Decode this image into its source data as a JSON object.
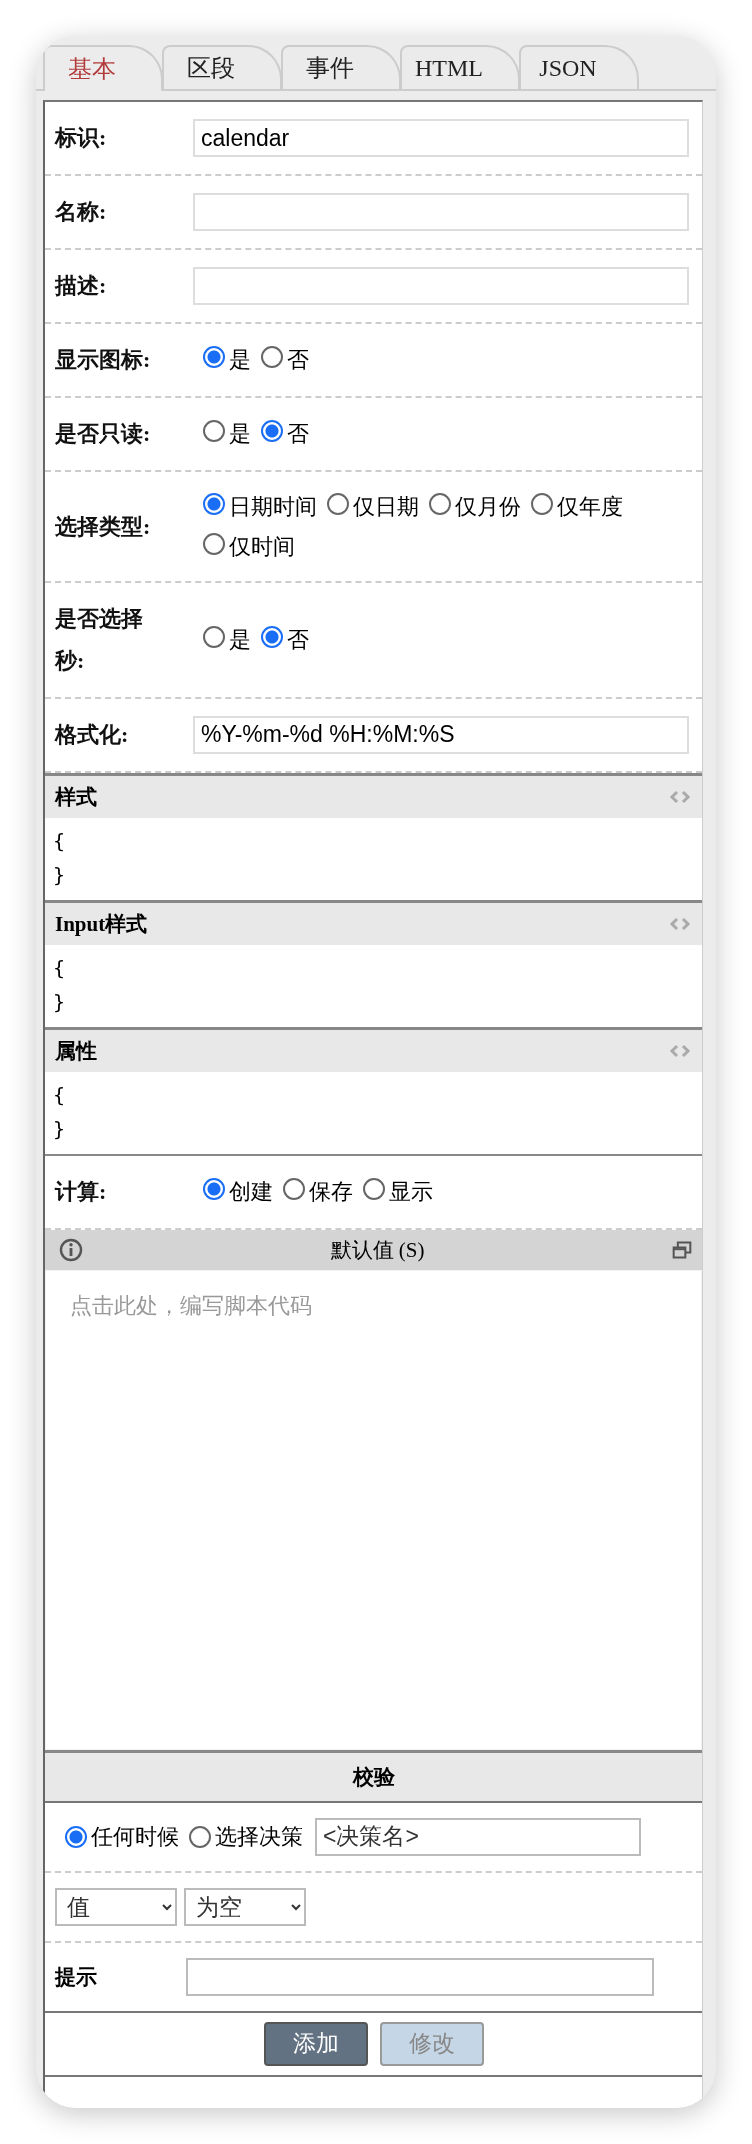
{
  "tabs": [
    {
      "label": "基本",
      "selected": true
    },
    {
      "label": "区段",
      "selected": false
    },
    {
      "label": "事件",
      "selected": false
    },
    {
      "label": "HTML",
      "selected": false
    },
    {
      "label": "JSON",
      "selected": false
    }
  ],
  "fields": [
    {
      "kind": "text",
      "label": "标识:",
      "value": "calendar"
    },
    {
      "kind": "text",
      "label": "名称:"
    },
    {
      "kind": "text",
      "label": "描述:"
    },
    {
      "kind": "radio",
      "label": "显示图标:",
      "options": [
        {
          "label": "是",
          "selected": true
        },
        {
          "label": "否",
          "selected": false
        }
      ]
    },
    {
      "kind": "radio",
      "label": "是否只读:",
      "options": [
        {
          "label": "是",
          "selected": false
        },
        {
          "label": "否",
          "selected": true
        }
      ]
    },
    {
      "kind": "radio",
      "label": "选择类型:",
      "options": [
        {
          "label": "日期时间",
          "selected": true
        },
        {
          "label": "仅日期",
          "selected": false
        },
        {
          "label": "仅月份",
          "selected": false
        },
        {
          "label": "仅年度",
          "selected": false
        },
        {
          "label": "仅时间",
          "selected": false
        }
      ]
    },
    {
      "kind": "radio",
      "label": "是否选择秒:",
      "options": [
        {
          "label": "是",
          "selected": false
        },
        {
          "label": "否",
          "selected": true
        }
      ]
    },
    {
      "kind": "text",
      "label": "格式化:",
      "value": "%Y-%m-%d %H:%M:%S"
    }
  ],
  "code_sections": [
    {
      "title": "样式",
      "lines": [
        "{",
        "}"
      ]
    },
    {
      "title": "Input样式",
      "lines": [
        "{",
        "}"
      ]
    },
    {
      "title": "属性",
      "lines": [
        "{",
        "}"
      ]
    }
  ],
  "calculation": {
    "label": "计算:",
    "options": [
      {
        "label": "创建",
        "selected": true
      },
      {
        "label": "保存",
        "selected": false
      },
      {
        "label": "显示",
        "selected": false
      }
    ]
  },
  "script_editor": {
    "title": "默认值 (S)",
    "placeholder": "点击此处，编写脚本代码"
  },
  "validation": {
    "title": "校验",
    "triggers": [
      {
        "label": "任何时候",
        "selected": true
      },
      {
        "label": "选择决策",
        "selected": false
      }
    ],
    "decision": {
      "value": "<决策名>"
    },
    "selects": [
      {
        "value": "值"
      },
      {
        "value": "为空"
      }
    ],
    "hint": {
      "label": "提示"
    },
    "buttons": [
      {
        "label": "添加",
        "disabled": false
      },
      {
        "label": "修改",
        "disabled": true
      }
    ]
  }
}
